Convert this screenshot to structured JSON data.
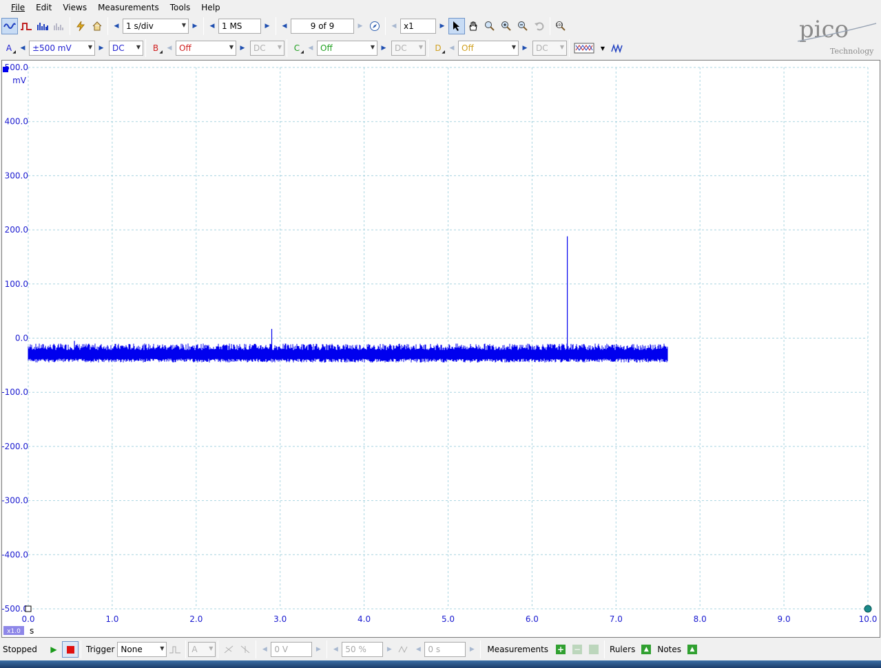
{
  "menu": {
    "items": [
      "File",
      "Edit",
      "Views",
      "Measurements",
      "Tools",
      "Help"
    ]
  },
  "toolbar": {
    "timebase": "1 s/div",
    "samples": "1 MS",
    "buffer": "9 of 9",
    "zoom": "x1"
  },
  "channels": {
    "a": {
      "label": "A",
      "range": "±500 mV",
      "coupling": "DC",
      "color": "#2020d0"
    },
    "b": {
      "label": "B",
      "range": "Off",
      "coupling": "DC",
      "color": "#d02020"
    },
    "c": {
      "label": "C",
      "range": "Off",
      "coupling": "DC",
      "color": "#20a020"
    },
    "d": {
      "label": "D",
      "range": "Off",
      "coupling": "DC",
      "color": "#d0a020"
    }
  },
  "logo": {
    "brand": "pico",
    "sub": "Technology"
  },
  "chart_data": {
    "type": "line",
    "y_unit": "mV",
    "x_unit": "s",
    "ylim": [
      -500,
      500
    ],
    "xlim": [
      0,
      10
    ],
    "y_ticks": [
      "500.0",
      "400.0",
      "300.0",
      "200.0",
      "100.0",
      "0.0",
      "-100.0",
      "-200.0",
      "-300.0",
      "-400.0",
      "-500.0"
    ],
    "x_ticks": [
      "0.0",
      "1.0",
      "2.0",
      "3.0",
      "4.0",
      "5.0",
      "6.0",
      "7.0",
      "8.0",
      "9.0",
      "10.0"
    ],
    "x_scale": "x1.0",
    "grid": true,
    "series": [
      {
        "color": "#0000ee",
        "baseline_mv": -30,
        "noise_band_mv": [
          -45,
          -10
        ],
        "end_s": 7.62,
        "spikes": [
          {
            "x": 0.55,
            "y": -5
          },
          {
            "x": 2.9,
            "y": 17
          },
          {
            "x": 6.42,
            "y": 188
          }
        ]
      }
    ]
  },
  "status": {
    "state": "Stopped",
    "trigger_label": "Trigger",
    "trigger_mode": "None",
    "trigger_channel": "A",
    "threshold": "0 V",
    "pretrigger": "50 %",
    "delay": "0 s",
    "measurements_label": "Measurements",
    "rulers_label": "Rulers",
    "notes_label": "Notes"
  }
}
